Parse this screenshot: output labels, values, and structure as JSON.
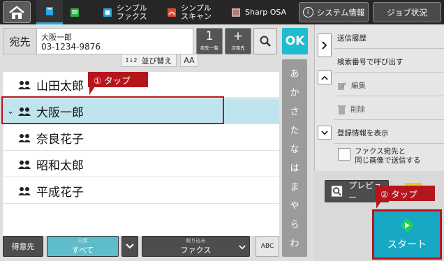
{
  "topbar": {
    "tabs": [
      {
        "label": "",
        "icon": "address-book-icon"
      },
      {
        "label": "",
        "icon": "fax-icon"
      },
      {
        "label": "シンプル\nファクス",
        "icon": "fax-simple-icon"
      },
      {
        "label": "シンプル\nスキャン",
        "icon": "scan-simple-icon"
      },
      {
        "label": "Sharp OSA",
        "icon": "osa-icon"
      }
    ],
    "system_info": "システム情報",
    "job_status": "ジョブ状況",
    "info_glyph": "i"
  },
  "destination": {
    "label": "宛先",
    "name": "大阪一郎",
    "number": "03-1234-9876",
    "count": "1",
    "count_caption": "宛先一覧",
    "next_glyph": "+",
    "next_caption": "次宛先",
    "ok": "OK"
  },
  "sort": {
    "label": "並び替え",
    "az_label": "AA"
  },
  "contacts": [
    {
      "name": "山田太郎",
      "selected": false
    },
    {
      "name": "大阪一郎",
      "selected": true
    },
    {
      "name": "奈良花子",
      "selected": false
    },
    {
      "name": "昭和太郎",
      "selected": false
    },
    {
      "name": "平成花子",
      "selected": false
    }
  ],
  "kana_index": [
    "あ",
    "か",
    "さ",
    "た",
    "な",
    "は",
    "ま",
    "や",
    "ら",
    "わ"
  ],
  "filters": {
    "favorite": "得意先",
    "category_caption": "分類",
    "category_value": "すべて",
    "narrow_caption": "絞り込み",
    "narrow_value": "ファクス",
    "abc": "ABC"
  },
  "right_panel": {
    "send_history": "送信履歴",
    "search_call": "検索番号で呼び出す",
    "edit": "編集",
    "delete": "削除",
    "show_registration": "登録情報を表示",
    "same_image_label": "ファクス宛先と\n同じ画像で送信する",
    "preview": "プレビュー",
    "start": "スタート"
  },
  "callouts": {
    "tap1": "① タップ",
    "tap2": "② タップ"
  },
  "colors": {
    "accent": "#1fbccc",
    "callout": "#b5161c",
    "selected_row": "#c0e4ed",
    "start_button": "#17a8c6"
  }
}
